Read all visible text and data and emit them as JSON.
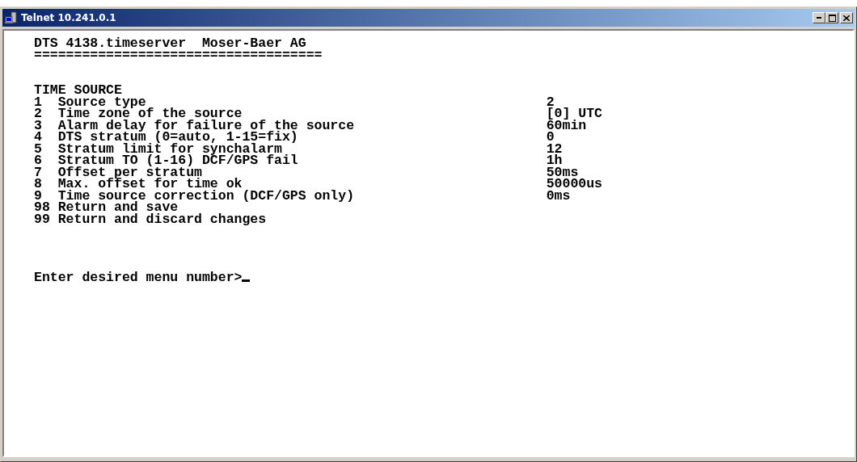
{
  "window": {
    "title": "Telnet 10.241.0.1"
  },
  "header": {
    "product": "DTS 4138.timeserver",
    "vendor": "Moser-Baer AG",
    "rule": "===================================="
  },
  "section_title": "TIME SOURCE",
  "menu_items": [
    {
      "number": "1",
      "label": "Source type",
      "value": "2"
    },
    {
      "number": "2",
      "label": "Time zone of the source",
      "value": "[0] UTC"
    },
    {
      "number": "3",
      "label": "Alarm delay for failure of the source",
      "value": "60min"
    },
    {
      "number": "4",
      "label": "DTS stratum (0=auto, 1-15=fix)",
      "value": "0"
    },
    {
      "number": "5",
      "label": "Stratum limit for synchalarm",
      "value": "12"
    },
    {
      "number": "6",
      "label": "Stratum TO (1-16) DCF/GPS fail",
      "value": "1h"
    },
    {
      "number": "7",
      "label": "Offset per stratum",
      "value": "50ms"
    },
    {
      "number": "8",
      "label": "Max. offset for time ok",
      "value": "50000us"
    },
    {
      "number": "9",
      "label": "Time source correction (DCF/GPS only)",
      "value": "0ms"
    },
    {
      "number": "98",
      "label": "Return and save"
    },
    {
      "number": "99",
      "label": "Return and discard changes"
    }
  ],
  "prompt": "Enter desired menu number>"
}
